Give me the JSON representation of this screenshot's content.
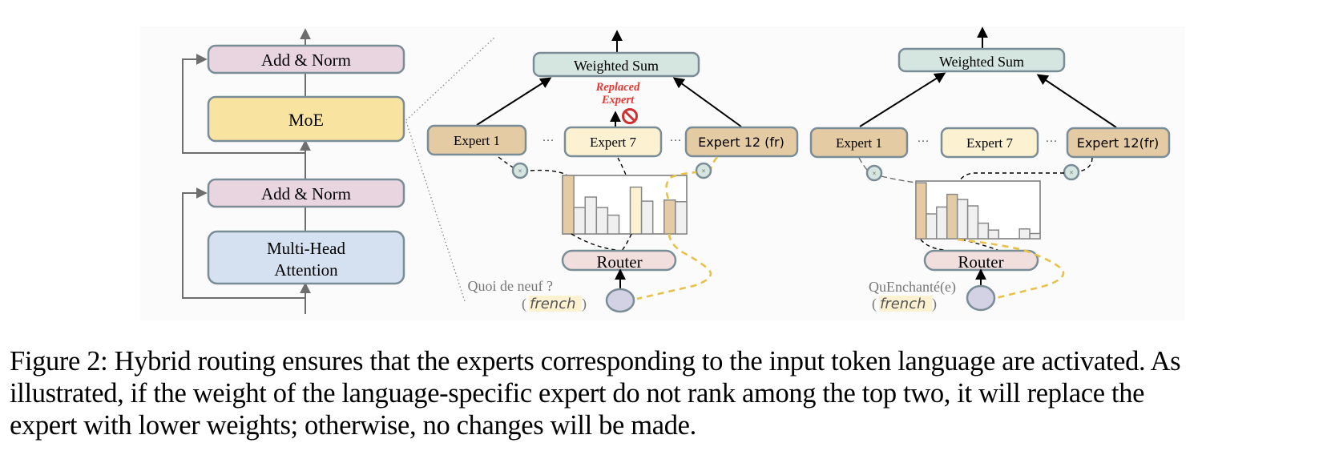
{
  "figure": {
    "transformer_block": {
      "blocks": [
        {
          "label": "Add & Norm",
          "role": "add-norm-top"
        },
        {
          "label": "MoE",
          "role": "moe"
        },
        {
          "label": "Add & Norm",
          "role": "add-norm-bottom"
        },
        {
          "label": "Multi-Head",
          "label2": "Attention",
          "role": "attention"
        }
      ]
    },
    "panel_left": {
      "weighted_sum_label": "Weighted Sum",
      "annotation": {
        "line1": "Replaced",
        "line2": "Expert",
        "color": "#e53935"
      },
      "experts": [
        {
          "label": "Expert 1",
          "state": "selected"
        },
        {
          "label": "Expert 7",
          "state": "replaced"
        },
        {
          "label": "Expert 12 (fr)",
          "state": "language"
        }
      ],
      "ellipsis": "···",
      "router_label": "Router",
      "input_text": "Quoi de neuf ?",
      "input_lang": "french",
      "router_weights": [
        1.0,
        0.45,
        0.63,
        0.45,
        0.32,
        0.0,
        0.8,
        0.56,
        0.0,
        0.58,
        0.55
      ],
      "bar_roles": [
        "selected",
        "other",
        "other",
        "other",
        "other",
        "none",
        "replaced",
        "other",
        "none",
        "language",
        "other"
      ]
    },
    "panel_right": {
      "weighted_sum_label": "Weighted Sum",
      "experts": [
        {
          "label": "Expert 1",
          "state": "selected"
        },
        {
          "label": "Expert 7",
          "state": "normal"
        },
        {
          "label": "Expert 12(fr)",
          "state": "language"
        }
      ],
      "ellipsis": "···",
      "router_label": "Router",
      "input_text": "QuEnchanté(e)",
      "input_lang": "french",
      "router_weights": [
        0.97,
        0.43,
        0.55,
        0.77,
        0.68,
        0.57,
        0.27,
        0.15,
        0.0,
        0.0,
        0.17,
        0.09
      ],
      "bar_roles": [
        "selected",
        "other",
        "other",
        "language",
        "other",
        "other",
        "other",
        "other",
        "none",
        "none",
        "other",
        "other"
      ]
    },
    "colors": {
      "add_norm": "#e8d5df",
      "moe": "#f8e4a0",
      "attention": "#d5e1f0",
      "weighted_sum": "#d5e5e0",
      "expert_selected": "#e5cba4",
      "expert_normal": "#fcf2d2",
      "router": "#f0dfdc",
      "token": "#d3d2e5",
      "bar_other": "#f0f0f0",
      "language_link": "#e8c14a",
      "border": "#7a8c96"
    }
  },
  "caption": {
    "lines": [
      "Figure 2: Hybrid routing ensures that the experts corresponding to the input token language are activated. As",
      "illustrated, if the weight of the language-specific expert do not rank among the top two, it will replace the",
      "expert with lower weights; otherwise, no changes will be made."
    ]
  }
}
